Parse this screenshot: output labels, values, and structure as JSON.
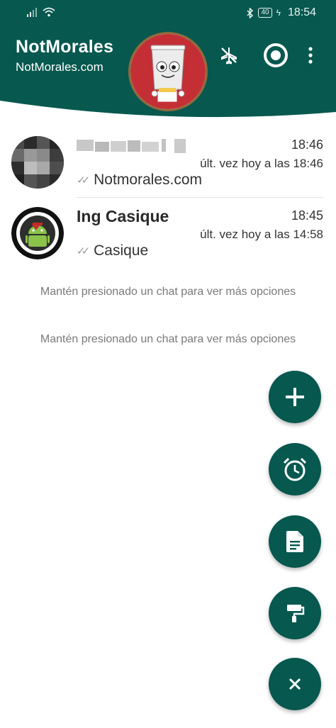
{
  "status_bar": {
    "time": "18:54",
    "battery": "40",
    "bluetooth_icon": "bluetooth-icon",
    "signal_icon": "signal-icon",
    "wifi_icon": "wifi-icon"
  },
  "header": {
    "title": "NotMorales",
    "subtitle": "NotMorales.com",
    "icons": [
      "airplane-off-icon",
      "target-icon",
      "more-vert-icon"
    ],
    "colors": {
      "primary": "#07584f",
      "accent_ring": "#8e6a3c",
      "avatar_bg": "#c42f36"
    }
  },
  "chats": [
    {
      "name": "",
      "name_blurred": true,
      "time": "18:46",
      "last_seen": "últ. vez hoy a las 18:46",
      "message": "Notmorales.com"
    },
    {
      "name": "Ing Casique",
      "time": "18:45",
      "last_seen": "últ. vez hoy a las 14:58",
      "message": "Casique"
    }
  ],
  "hints": [
    "Mantén presionado un chat para ver más opciones",
    "Mantén presionado un chat para ver más opciones"
  ],
  "fab_icons": [
    "plus-icon",
    "alarm-icon",
    "document-icon",
    "paint-roller-icon",
    "close-icon"
  ]
}
